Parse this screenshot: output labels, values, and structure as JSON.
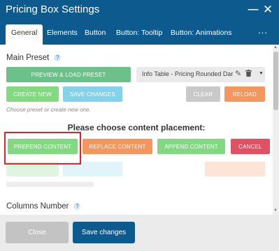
{
  "window": {
    "title": "Pricing Box Settings",
    "minimize_glyph": "—",
    "close_glyph": "✕"
  },
  "tabs": [
    {
      "label": "General",
      "active": true
    },
    {
      "label": "Elements"
    },
    {
      "label": "Button"
    },
    {
      "label": "Button: Tooltip"
    },
    {
      "label": "Button: Animations"
    }
  ],
  "tabs_more": "...",
  "main_preset": {
    "label": "Main Preset",
    "help": "?",
    "preview_button": "PREVIEW & LOAD PRESET",
    "selected_preset": "Info Table - Pricing Rounded Dark",
    "create_new": "CREATE NEW",
    "save_changes": "SAVE CHANGES",
    "clear": "CLEAR",
    "reload": "RELOAD",
    "hint": "Choose preset or create new one."
  },
  "placement": {
    "title": "Please choose content placement:",
    "prepend": "PREPEND CONTENT",
    "replace": "REPLACE CONTENT",
    "append": "APPEND CONTENT",
    "cancel": "CANCEL"
  },
  "columns": {
    "label": "Columns Number",
    "help": "?"
  },
  "footer": {
    "close": "Close",
    "save": "Save changes"
  },
  "colors": {
    "header": "#0d5a8f",
    "green": "#82d982",
    "orange": "#f3975f",
    "red": "#e05163",
    "highlight": "#d8262e"
  }
}
